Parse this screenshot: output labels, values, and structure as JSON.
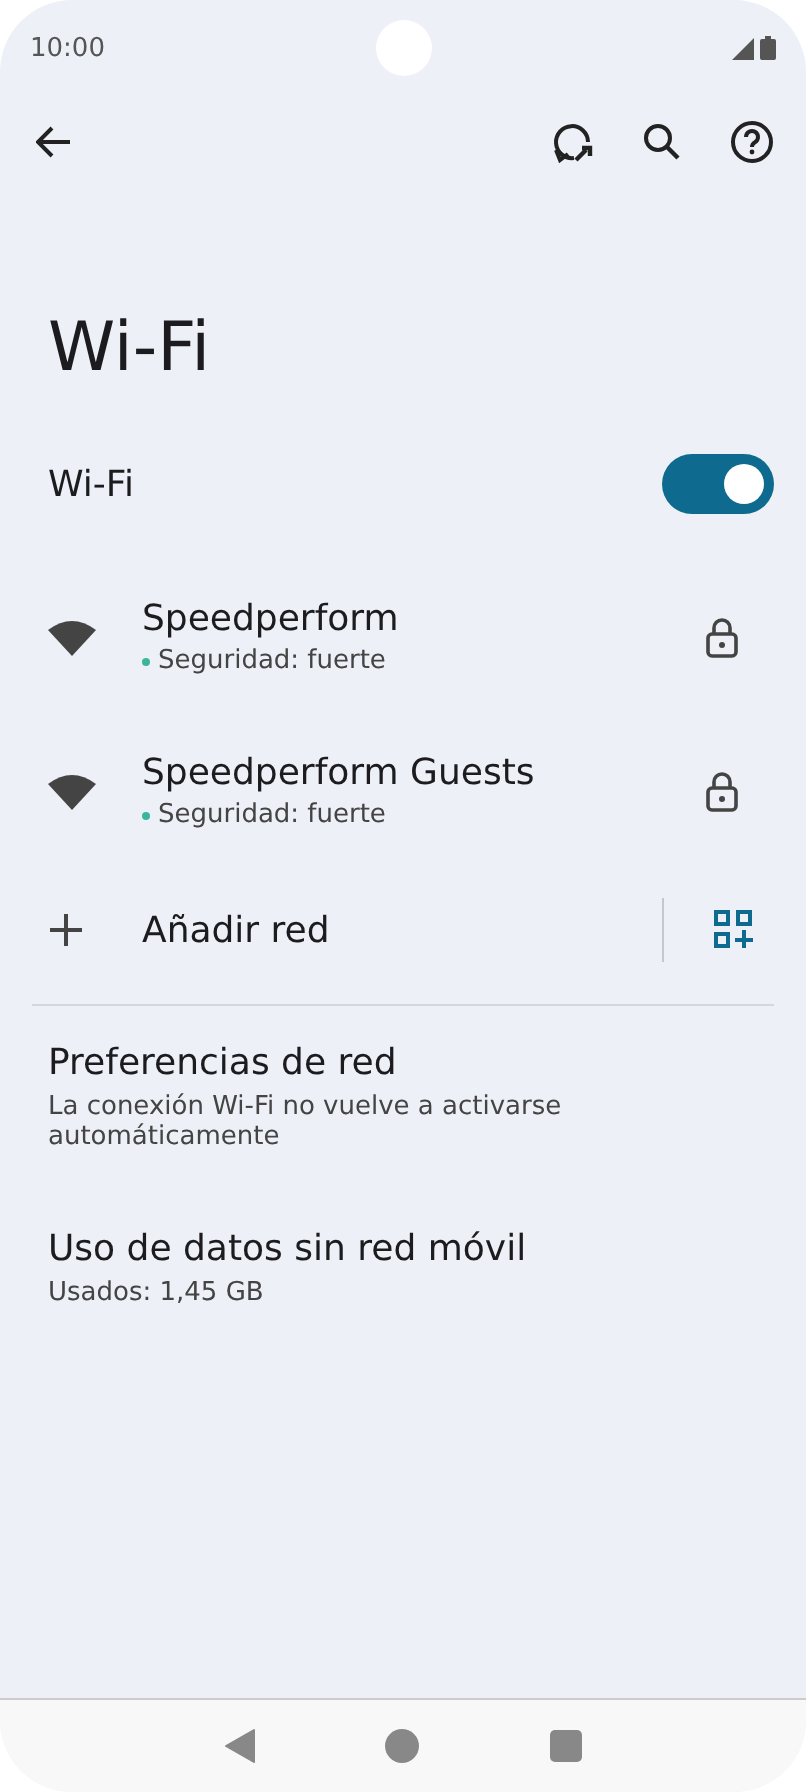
{
  "status_bar": {
    "time": "10:00"
  },
  "title": "Wi-Fi",
  "wifi_toggle": {
    "label": "Wi-Fi",
    "on": true
  },
  "networks": [
    {
      "name": "Speedperform",
      "status": "Seguridad: fuerte",
      "color": "#3bb59c",
      "locked": true
    },
    {
      "name": "Speedperform Guests",
      "status": "Seguridad: fuerte",
      "color": "#3bb59c",
      "locked": true
    }
  ],
  "add_network": {
    "label": "Añadir red"
  },
  "settings": [
    {
      "title": "Preferencias de red",
      "subtitle": "La conexión Wi-Fi no vuelve a activarse automáticamente"
    },
    {
      "title": "Uso de datos sin red móvil",
      "subtitle": "Usados: 1,45 GB"
    }
  ]
}
